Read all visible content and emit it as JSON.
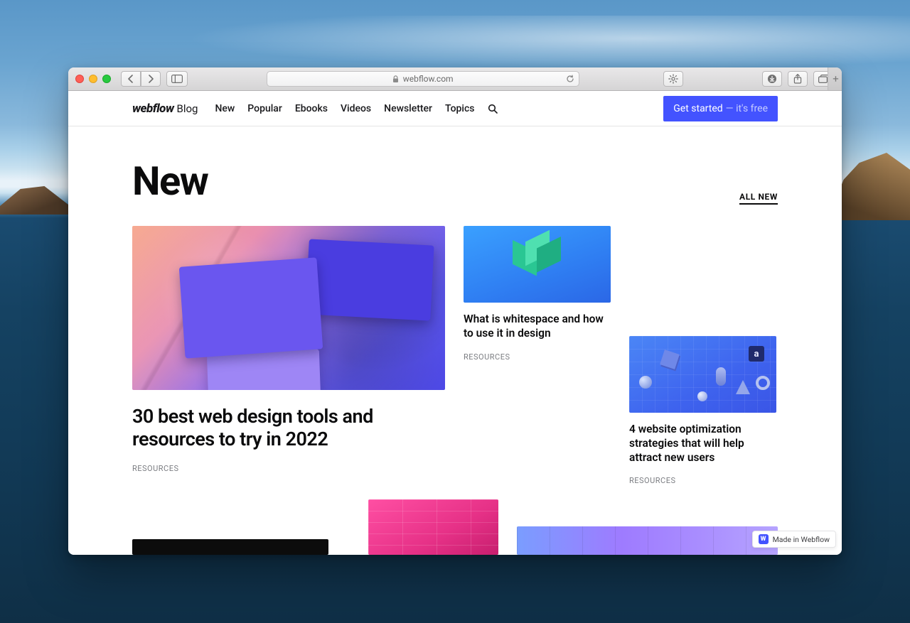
{
  "browser": {
    "url_host": "webflow.com",
    "buttons": {
      "back": "‹",
      "forward": "›"
    }
  },
  "nav": {
    "brand_strong": "webflow",
    "brand_sub": "Blog",
    "items": [
      "New",
      "Popular",
      "Ebooks",
      "Videos",
      "Newsletter",
      "Topics"
    ],
    "cta_main": "Get started",
    "cta_sub": "— it's free"
  },
  "section": {
    "title": "New",
    "all_link": "ALL NEW"
  },
  "cards": {
    "feature": {
      "title": "30 best web design tools and resources to try in 2022",
      "tag": "RESOURCES"
    },
    "c2": {
      "title": "What is whitespace and how to use it in design",
      "tag": "RESOURCES"
    },
    "c3": {
      "title": "4 website optimization strategies that will help attract new users",
      "tag": "RESOURCES"
    }
  },
  "badge": {
    "label": "Made in Webflow",
    "icon_text": "W"
  }
}
